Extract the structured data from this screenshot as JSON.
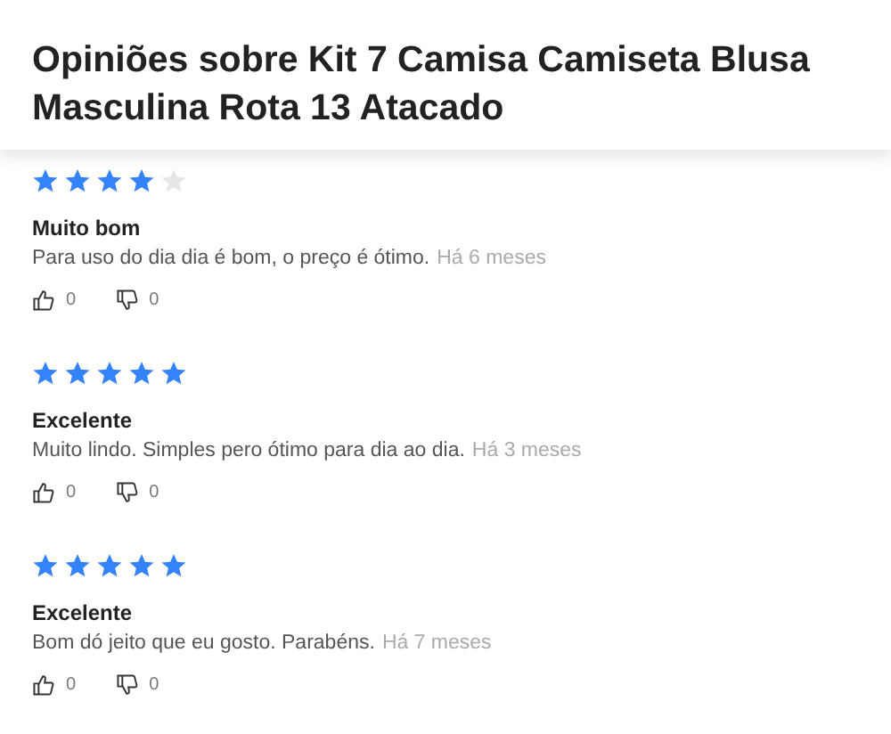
{
  "header": {
    "title": "Opiniões sobre Kit 7 Camisa Camiseta Blusa Masculina Rota 13 Atacado"
  },
  "reviews": [
    {
      "stars": 4,
      "title": "Muito bom",
      "text": "Para uso do dia dia é bom, o preço é ótimo.",
      "time": "Há 6 meses",
      "likes": "0",
      "dislikes": "0"
    },
    {
      "stars": 5,
      "title": "Excelente",
      "text": "Muito lindo. Simples pero ótimo para dia ao dia.",
      "time": "Há 3 meses",
      "likes": "0",
      "dislikes": "0"
    },
    {
      "stars": 5,
      "title": "Excelente",
      "text": "Bom dó jeito que eu gosto. Parabéns.",
      "time": "Há 7 meses",
      "likes": "0",
      "dislikes": "0"
    }
  ]
}
